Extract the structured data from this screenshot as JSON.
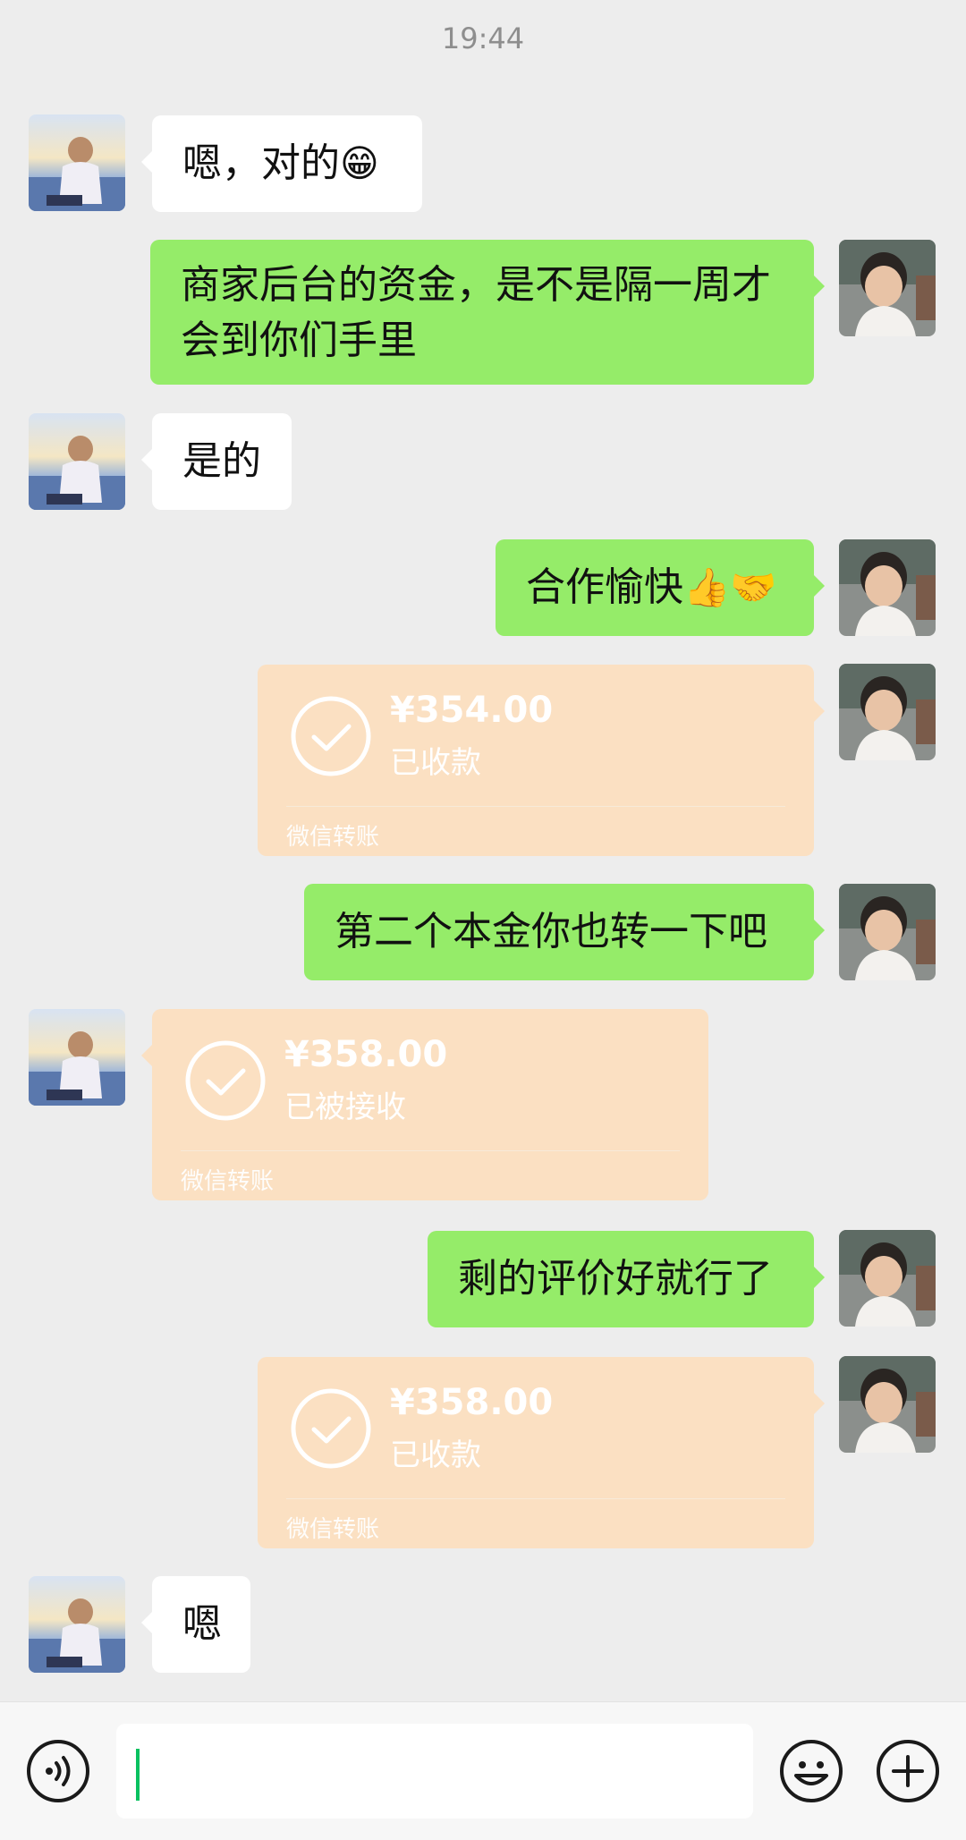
{
  "chat": {
    "timestamp": "19:44",
    "messages": {
      "m1": {
        "text": "嗯，对的",
        "emoji": "😁"
      },
      "m2": {
        "line1": "商家后台的资金，是不是隔一周才",
        "line2": "会到你们手里"
      },
      "m3": {
        "text": "是的"
      },
      "m4": {
        "text": "合作愉快",
        "emoji": "👍🤝"
      },
      "t1": {
        "amount": "¥354.00",
        "status": "已收款",
        "footer": "微信转账"
      },
      "m5": {
        "text": "第二个本金你也转一下吧"
      },
      "t2": {
        "amount": "¥358.00",
        "status": "已被接收",
        "footer": "微信转账"
      },
      "m6": {
        "text": "剩的评价好就行了"
      },
      "t3": {
        "amount": "¥358.00",
        "status": "已收款",
        "footer": "微信转账"
      },
      "m7": {
        "text": "嗯"
      }
    }
  },
  "input_bar": {
    "voice_icon": "voice-icon",
    "emoji_icon": "emoji-icon",
    "plus_icon": "plus-icon"
  },
  "colors": {
    "background": "#ededed",
    "self_bubble": "#95ec69",
    "other_bubble": "#ffffff",
    "transfer": "#fbe0c2",
    "caret": "#07c160"
  }
}
